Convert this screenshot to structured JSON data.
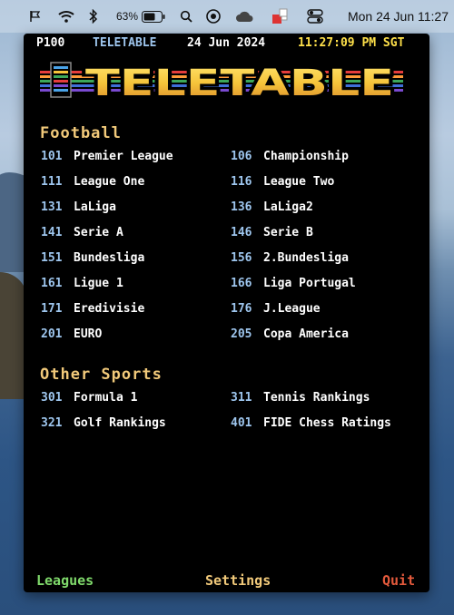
{
  "menubar": {
    "battery_percent": "63%",
    "clock": "Mon 24 Jun  11:27",
    "icons": [
      "flag-icon",
      "wifi-icon",
      "bluetooth-icon",
      "battery-icon",
      "search-icon",
      "focus-icon",
      "cloud-icon",
      "teletable-menu-icon",
      "control-center-icon"
    ]
  },
  "status": {
    "page": "P100",
    "title": "TELETABLE",
    "date": "24 Jun 2024",
    "time": "11:27:09 PM SGT"
  },
  "banner": {
    "text": "TELETABLE"
  },
  "football": {
    "title": "Football",
    "left": [
      {
        "num": "101",
        "label": "Premier League"
      },
      {
        "num": "111",
        "label": "League One"
      },
      {
        "num": "131",
        "label": "LaLiga"
      },
      {
        "num": "141",
        "label": "Serie A"
      },
      {
        "num": "151",
        "label": "Bundesliga"
      },
      {
        "num": "161",
        "label": "Ligue 1"
      },
      {
        "num": "171",
        "label": "Eredivisie"
      },
      {
        "num": "201",
        "label": "EURO"
      }
    ],
    "right": [
      {
        "num": "106",
        "label": "Championship"
      },
      {
        "num": "116",
        "label": "League Two"
      },
      {
        "num": "136",
        "label": "LaLiga2"
      },
      {
        "num": "146",
        "label": "Serie B"
      },
      {
        "num": "156",
        "label": "2.Bundesliga"
      },
      {
        "num": "166",
        "label": "Liga Portugal"
      },
      {
        "num": "176",
        "label": "J.League"
      },
      {
        "num": "205",
        "label": "Copa America"
      }
    ]
  },
  "other": {
    "title": "Other Sports",
    "left": [
      {
        "num": "301",
        "label": "Formula 1"
      },
      {
        "num": "321",
        "label": "Golf Rankings"
      }
    ],
    "right": [
      {
        "num": "311",
        "label": "Tennis Rankings"
      },
      {
        "num": "401",
        "label": "FIDE Chess Ratings"
      }
    ]
  },
  "footer": {
    "leagues": "Leagues",
    "settings": "Settings",
    "quit": "Quit"
  },
  "colors": {
    "number": "#9ec6ee",
    "label": "#ffffff",
    "section": "#f1c97a",
    "time": "#ffe14a",
    "leagues": "#7fd96b",
    "quit": "#e45a3c"
  }
}
